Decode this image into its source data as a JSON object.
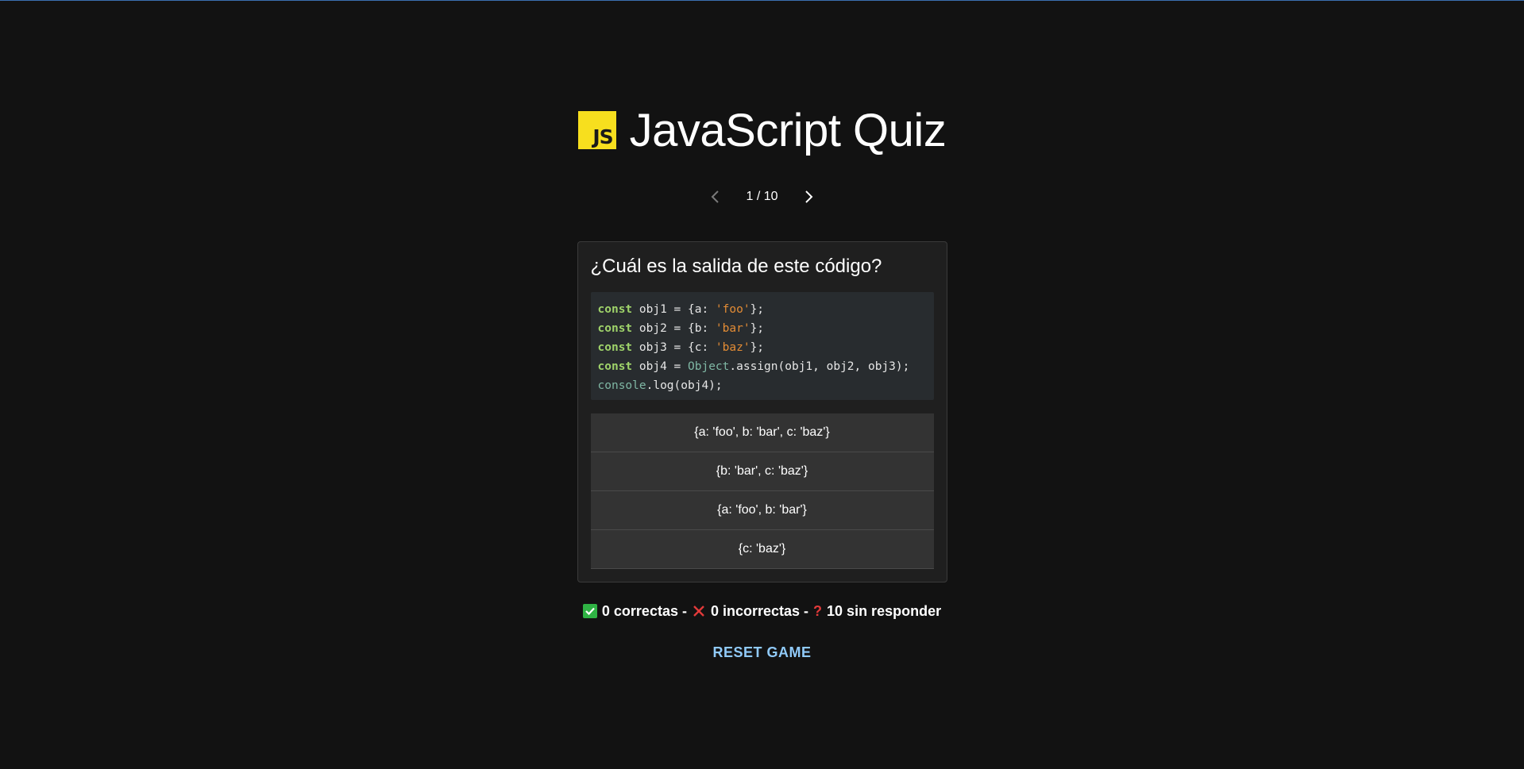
{
  "app": {
    "title": "JavaScript Quiz",
    "logo_text": "JS"
  },
  "pager": {
    "label": "1 / 10",
    "prev_icon": "chevron-left-icon",
    "next_icon": "chevron-right-icon"
  },
  "question": {
    "text": "¿Cuál es la salida de este código?",
    "code_lines": [
      [
        {
          "t": "kw",
          "v": "const"
        },
        {
          "t": "p",
          "v": " obj1 = {a: "
        },
        {
          "t": "str",
          "v": "'foo'"
        },
        {
          "t": "p",
          "v": "};"
        }
      ],
      [
        {
          "t": "kw",
          "v": "const"
        },
        {
          "t": "p",
          "v": " obj2 = {b: "
        },
        {
          "t": "str",
          "v": "'bar'"
        },
        {
          "t": "p",
          "v": "};"
        }
      ],
      [
        {
          "t": "kw",
          "v": "const"
        },
        {
          "t": "p",
          "v": " obj3 = {c: "
        },
        {
          "t": "str",
          "v": "'baz'"
        },
        {
          "t": "p",
          "v": "};"
        }
      ],
      [
        {
          "t": "kw",
          "v": "const"
        },
        {
          "t": "p",
          "v": " obj4 = "
        },
        {
          "t": "obj",
          "v": "Object"
        },
        {
          "t": "p",
          "v": ".assign(obj1, obj2, obj3);"
        }
      ],
      [
        {
          "t": "obj",
          "v": "console"
        },
        {
          "t": "p",
          "v": ".log(obj4);"
        }
      ]
    ],
    "answers": [
      "{a: 'foo', b: 'bar', c: 'baz'}",
      "{b: 'bar', c: 'baz'}",
      "{a: 'foo', b: 'bar'}",
      "{c: 'baz'}"
    ]
  },
  "score": {
    "correct": "0 correctas -",
    "incorrect": "0 incorrectas -",
    "unanswered": "10 sin responder",
    "unanswered_glyph": "?"
  },
  "reset_label": "RESET GAME",
  "colors": {
    "background": "#121212",
    "js_yellow": "#f7df1e",
    "accent": "#90caf9",
    "check": "#2fb344",
    "cross": "#e23a3a"
  }
}
